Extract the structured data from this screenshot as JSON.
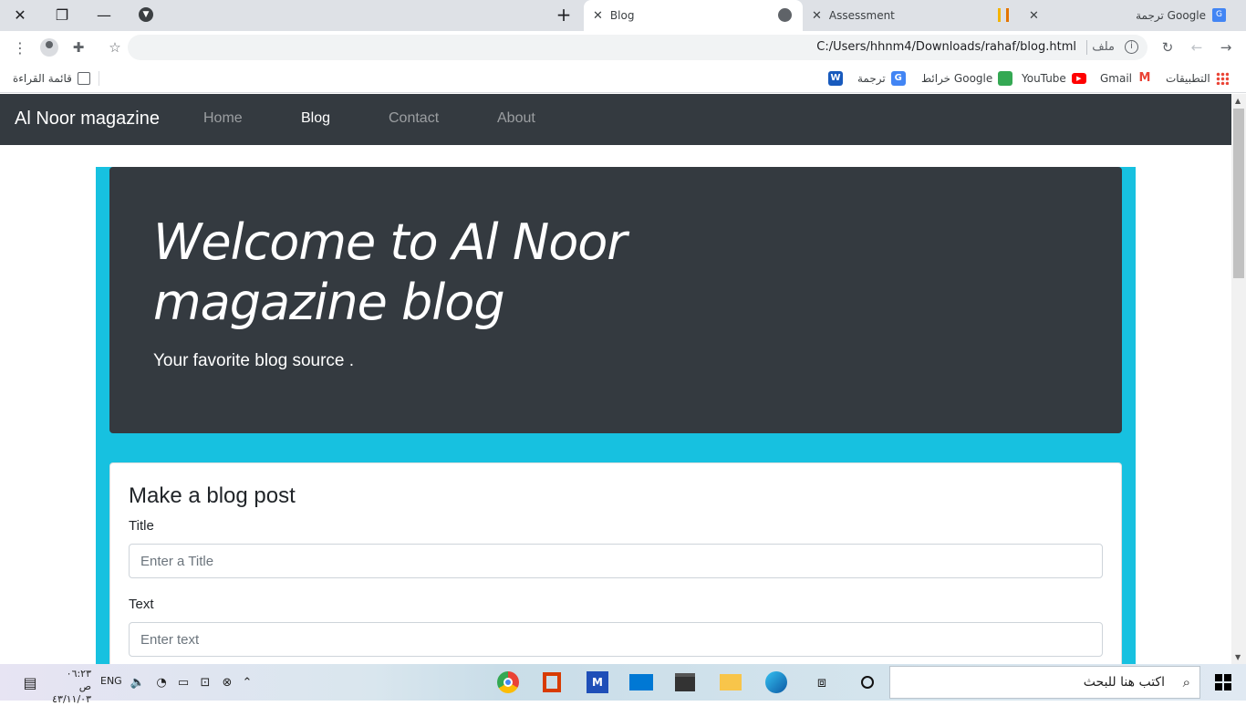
{
  "browser": {
    "tabs": [
      {
        "label": "Blog"
      },
      {
        "label": "Assessment"
      },
      {
        "label": "ترجمة Google"
      }
    ],
    "address": "C:/Users/hhnm4/Downloads/rahaf/blog.html",
    "address_prefix": "ملف",
    "bookmarks": [
      {
        "label": "التطبيقات"
      },
      {
        "label": "Gmail"
      },
      {
        "label": "YouTube"
      },
      {
        "label": "خرائط Google"
      },
      {
        "label": "ترجمة"
      }
    ],
    "reading_list": "قائمة القراءة"
  },
  "page": {
    "brand": "Al Noor magazine",
    "nav": [
      "Home",
      "Blog",
      "Contact",
      "About"
    ],
    "hero": {
      "title": "Welcome to Al Noor magazine blog",
      "lead": "Your favorite blog source ."
    },
    "form": {
      "heading": "Make a blog post",
      "title_label": "Title",
      "title_placeholder": "Enter a Title",
      "text_label": "Text",
      "text_placeholder": "Enter text"
    }
  },
  "taskbar": {
    "search_placeholder": "اكتب هنا للبحث",
    "language": "ENG",
    "time": "٠٦:٢٣ ص",
    "date": "٤٣/١١/٠٣"
  },
  "colors": {
    "navbar": "#343a40",
    "container_bg": "#17c1e0",
    "jumbotron": "#343a40"
  }
}
